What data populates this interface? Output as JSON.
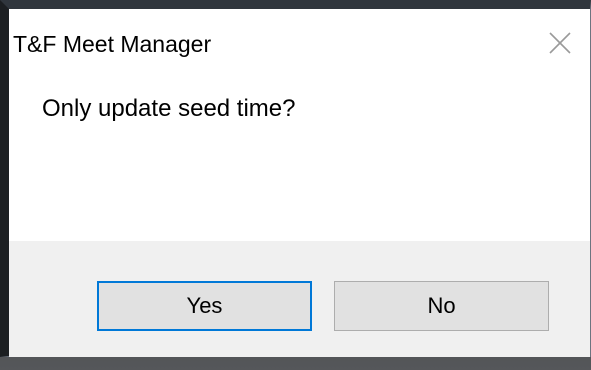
{
  "dialog": {
    "title": "T&F Meet Manager",
    "message": "Only update seed time?",
    "buttons": {
      "yes_label": "Yes",
      "no_label": "No"
    },
    "close_icon": "close-icon",
    "colors": {
      "default_button_border": "#0078d7",
      "footer_bg": "#f0f0f0",
      "button_bg": "#e1e1e1"
    }
  }
}
